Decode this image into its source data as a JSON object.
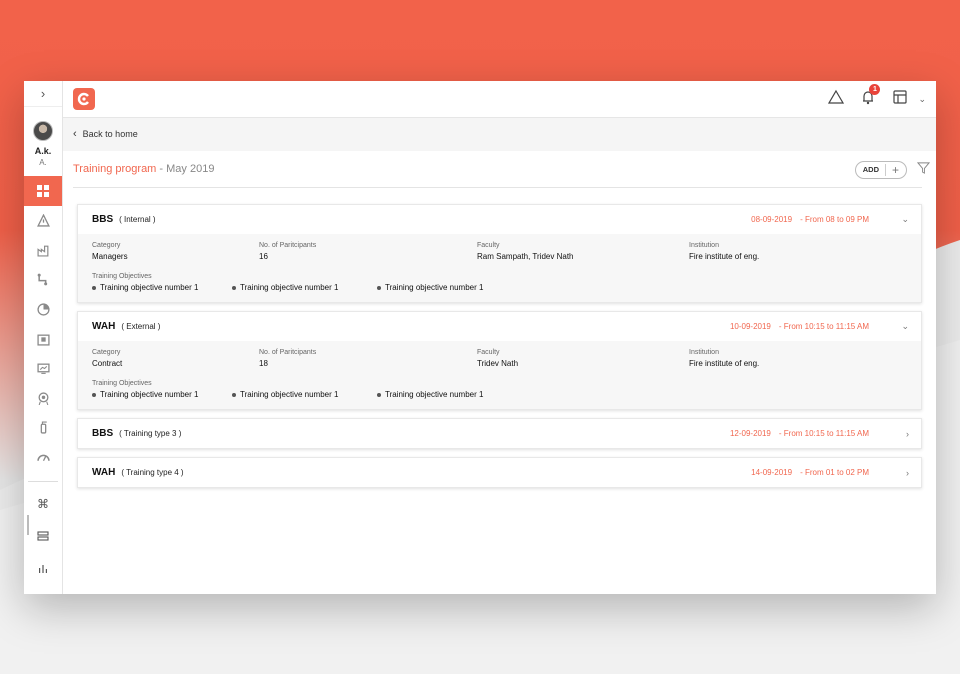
{
  "sidebar": {
    "expand_icon": "chevron-right-icon",
    "user_name": "A.k.",
    "user_initial": "A.",
    "nav_icons": [
      "dashboard-icon",
      "warning-icon",
      "factory-icon",
      "pipeline-icon",
      "chart-icon",
      "archive-icon",
      "monitor-icon",
      "badge-icon",
      "extinguisher-icon",
      "gauge-icon"
    ],
    "bottom_icons": [
      "command-icon",
      "list-icon",
      "bar-chart-icon"
    ]
  },
  "topbar": {
    "logo": "app-logo",
    "notification_count": "1",
    "icons": [
      "alert-triangle-icon",
      "bell-icon",
      "layout-icon",
      "chevron-down-icon"
    ]
  },
  "back": {
    "label": "Back to home"
  },
  "page": {
    "title": "Training program",
    "subtitle": " - May 2019",
    "add_label": "ADD",
    "plus_label": "+"
  },
  "labels": {
    "category": "Category",
    "participants": "No. of Paritcipants",
    "faculty": "Faculty",
    "institution": "Institution",
    "objectives": "Training Objectives"
  },
  "cards": [
    {
      "title": "BBS",
      "type": "( Internal )",
      "date": "08-09-2019",
      "time": "- From 08 to 09 PM",
      "expanded": true,
      "category": "Managers",
      "participants": "16",
      "faculty": "Ram Sampath, Tridev Nath",
      "institution": "Fire institute of eng.",
      "objectives": [
        "Training objective number 1",
        "Training objective number 1",
        "Training objective number 1"
      ]
    },
    {
      "title": "WAH",
      "type": "( External )",
      "date": "10-09-2019",
      "time": "- From 10:15 to 11:15 AM",
      "expanded": true,
      "category": "Contract",
      "participants": "18",
      "faculty": "Tridev Nath",
      "institution": "Fire institute of eng.",
      "objectives": [
        "Training objective number 1",
        "Training objective number 1",
        "Training objective number 1"
      ]
    },
    {
      "title": "BBS",
      "type": "( Training type 3 )",
      "date": "12-09-2019",
      "time": "- From 10:15 to 11:15 AM",
      "expanded": false
    },
    {
      "title": "WAH",
      "type": "( Training type 4 )",
      "date": "14-09-2019",
      "time": "- From 01 to 02 PM",
      "expanded": false
    }
  ],
  "colors": {
    "accent": "#f1674f",
    "badge": "#e9433a"
  }
}
